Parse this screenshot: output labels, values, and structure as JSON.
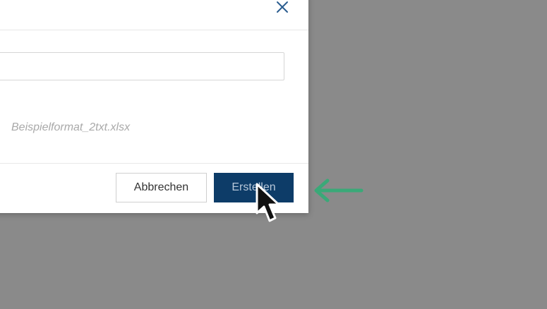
{
  "dialog": {
    "name_input": {
      "value": "",
      "placeholder": ""
    },
    "selected_file": "Beispielformat_2txt.xlsx",
    "buttons": {
      "cancel_label": "Abbrechen",
      "create_label": "Erstellen"
    },
    "icons": {
      "close": "close-icon"
    }
  },
  "annotation": {
    "arrow_icon": "arrow-left-icon",
    "arrow_color": "#3aa978"
  },
  "colors": {
    "overlay": "#8a8a8a",
    "primary_button": "#0d3c68",
    "muted_text": "#a9a9a9"
  }
}
